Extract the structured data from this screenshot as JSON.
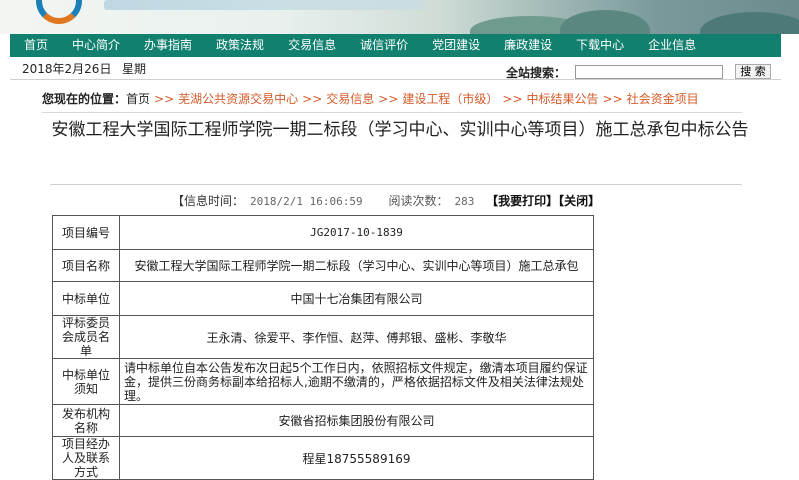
{
  "nav": {
    "items": [
      "首页",
      "中心简介",
      "办事指南",
      "政策法规",
      "交易信息",
      "诚信评价",
      "党团建设",
      "廉政建设",
      "下载中心",
      "企业信息"
    ]
  },
  "datebar": {
    "date": "2018年2月26日",
    "weekday": "星期",
    "search_label": "全站搜索：",
    "search_value": "",
    "search_button": "搜 索"
  },
  "breadcrumb": {
    "label": "您现在的位置：",
    "home": "首页",
    "separator": ">>",
    "items": [
      "芜湖公共资源交易中心",
      "交易信息",
      "建设工程（市级）",
      "中标结果公告",
      "社会资金项目"
    ]
  },
  "article": {
    "title": "安徽工程大学国际工程师学院一期二标段（学习中心、实训中心等项目）施工总承包中标公告",
    "info_time_label": "【信息时间：",
    "info_time": "2018/2/1 16:06:59",
    "views_label": "阅读次数：",
    "views": "283",
    "print_label": "【我要打印】",
    "close_label": "【关闭】"
  },
  "table": {
    "rows": [
      {
        "key": "项目编号",
        "value": "JG2017-10-1839"
      },
      {
        "key": "项目名称",
        "value": "安徽工程大学国际工程师学院一期二标段（学习中心、实训中心等项目）施工总承包"
      },
      {
        "key": "中标单位",
        "value": "中国十七冶集团有限公司"
      },
      {
        "key": "评标委员会成员名单",
        "value": "王永清、徐爱平、李作恒、赵萍、傅邦银、盛彬、李敬华"
      },
      {
        "key": "中标单位须知",
        "value": "请中标单位自本公告发布次日起5个工作日内，依照招标文件规定，缴清本项目履约保证金，提供三份商务标副本给招标人,逾期不缴清的，严格依据招标文件及相关法律法规处理。"
      },
      {
        "key": "发布机构名称",
        "value": "安徽省招标集团股份有限公司"
      },
      {
        "key": "项目经办人及联系方式",
        "value": "程星18755589169"
      }
    ]
  },
  "colors": {
    "nav_bg": "#12806f",
    "link": "#d25b29"
  }
}
